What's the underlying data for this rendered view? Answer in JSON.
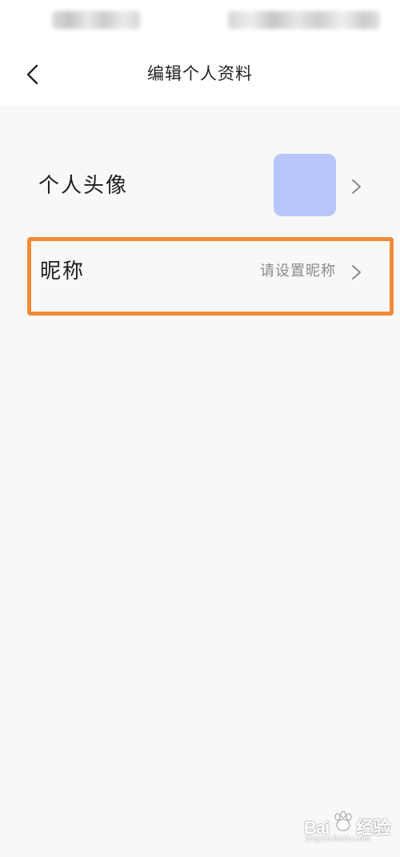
{
  "header": {
    "title": "编辑个人资料",
    "back_icon": "chevron-left-icon"
  },
  "rows": {
    "avatar": {
      "label": "个人头像",
      "avatar_color": "#b8c6fb",
      "chevron_icon": "chevron-right-icon"
    },
    "nickname": {
      "label": "昵称",
      "value": "请设置昵称",
      "chevron_icon": "chevron-right-icon"
    }
  },
  "highlight": {
    "color": "#f28a35"
  },
  "watermark": {
    "logo": "Bai",
    "suffix": "经验",
    "url": "jingyan.baidu.com"
  }
}
